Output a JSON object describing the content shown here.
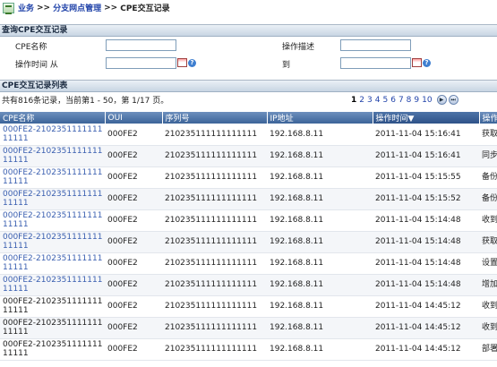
{
  "breadcrumb": {
    "part1": "业务",
    "sep1": ">>",
    "part2": "分支网点管理",
    "sep2": ">>",
    "part3": "CPE交互记录"
  },
  "query": {
    "title": "查询CPE交互记录",
    "cpe_name_label": "CPE名称",
    "op_desc_label": "操作描述",
    "op_time_label": "操作时间",
    "from_label": "从",
    "to_label": "到"
  },
  "list": {
    "title": "CPE交互记录列表",
    "summary": "共有816条记录，当前第1 - 50，第 1/17 页。",
    "pages": [
      "1",
      "2",
      "3",
      "4",
      "5",
      "6",
      "7",
      "8",
      "9",
      "10"
    ],
    "current_page": "1"
  },
  "table": {
    "headers": [
      "CPE名称",
      "OUI",
      "序列号",
      "IP地址",
      "操作时间",
      "操作"
    ],
    "sort_arrow": "▼",
    "rows": [
      {
        "name": "000FE2-210235111111111111",
        "oui": "000FE2",
        "serial": "210235111111111111",
        "ip": "192.168.8.11",
        "time": "2011-11-04 15:16:41",
        "op": "获取",
        "link": true
      },
      {
        "name": "000FE2-210235111111111111",
        "oui": "000FE2",
        "serial": "210235111111111111",
        "ip": "192.168.8.11",
        "time": "2011-11-04 15:16:41",
        "op": "同步",
        "link": true
      },
      {
        "name": "000FE2-210235111111111111",
        "oui": "000FE2",
        "serial": "210235111111111111",
        "ip": "192.168.8.11",
        "time": "2011-11-04 15:15:55",
        "op": "备份 成功",
        "link": true
      },
      {
        "name": "000FE2-210235111111111111",
        "oui": "000FE2",
        "serial": "210235111111111111",
        "ip": "192.168.8.11",
        "time": "2011-11-04 15:15:52",
        "op": "备份 成功",
        "link": true
      },
      {
        "name": "000FE2-210235111111111111",
        "oui": "000FE2",
        "serial": "210235111111111111",
        "ip": "192.168.8.11",
        "time": "2011-11-04 15:14:48",
        "op": "收到",
        "link": true
      },
      {
        "name": "000FE2-210235111111111111",
        "oui": "000FE2",
        "serial": "210235111111111111",
        "ip": "192.168.8.11",
        "time": "2011-11-04 15:14:48",
        "op": "获取",
        "link": true
      },
      {
        "name": "000FE2-210235111111111111",
        "oui": "000FE2",
        "serial": "210235111111111111",
        "ip": "192.168.8.11",
        "time": "2011-11-04 15:14:48",
        "op": "设置",
        "link": true
      },
      {
        "name": "000FE2-210235111111111111",
        "oui": "000FE2",
        "serial": "210235111111111111",
        "ip": "192.168.8.11",
        "time": "2011-11-04 15:14:48",
        "op": "增加",
        "link": true
      },
      {
        "name": "000FE2-210235111111111111",
        "oui": "000FE2",
        "serial": "210235111111111111",
        "ip": "192.168.8.11",
        "time": "2011-11-04 14:45:12",
        "op": "收到",
        "link": false
      },
      {
        "name": "000FE2-210235111111111111",
        "oui": "000FE2",
        "serial": "210235111111111111",
        "ip": "192.168.8.11",
        "time": "2011-11-04 14:45:12",
        "op": "收到",
        "link": false
      },
      {
        "name": "000FE2-210235111111111111",
        "oui": "000FE2",
        "serial": "210235111111111111",
        "ip": "192.168.8.11",
        "time": "2011-11-04 14:45:12",
        "op": "部署 因未",
        "link": false
      }
    ]
  }
}
